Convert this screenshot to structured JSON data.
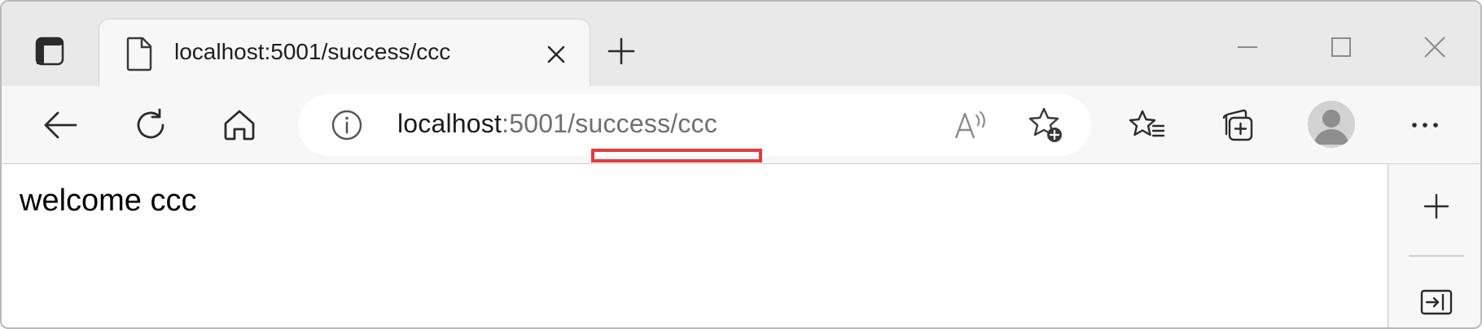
{
  "window": {
    "controls": [
      "minimize-icon",
      "maximize-icon",
      "close-icon"
    ]
  },
  "tabstrip": {
    "tab_actions_icon": "tab-actions-icon",
    "active_tab": {
      "title": "localhost:5001/success/ccc",
      "icon": "page-icon",
      "close_icon": "close-icon"
    },
    "new_tab_icon": "plus-icon"
  },
  "toolbar": {
    "back_icon": "back-arrow-icon",
    "refresh_icon": "refresh-icon",
    "home_icon": "home-icon",
    "address": {
      "info_icon": "info-icon",
      "host": "localhost",
      "path": ":5001/success/ccc",
      "read_aloud_icon": "read-aloud-icon",
      "favorite_icon": "add-favorite-icon"
    },
    "favorites_icon": "favorites-icon",
    "collections_icon": "collections-icon",
    "profile_icon": "profile-avatar",
    "more_icon": "more-icon"
  },
  "annotation": {
    "color": "#e03c3c"
  },
  "content": {
    "text": "welcome ccc"
  },
  "sidebar": {
    "add_icon": "plus-icon",
    "hide_icon": "hide-sidebar-icon"
  }
}
